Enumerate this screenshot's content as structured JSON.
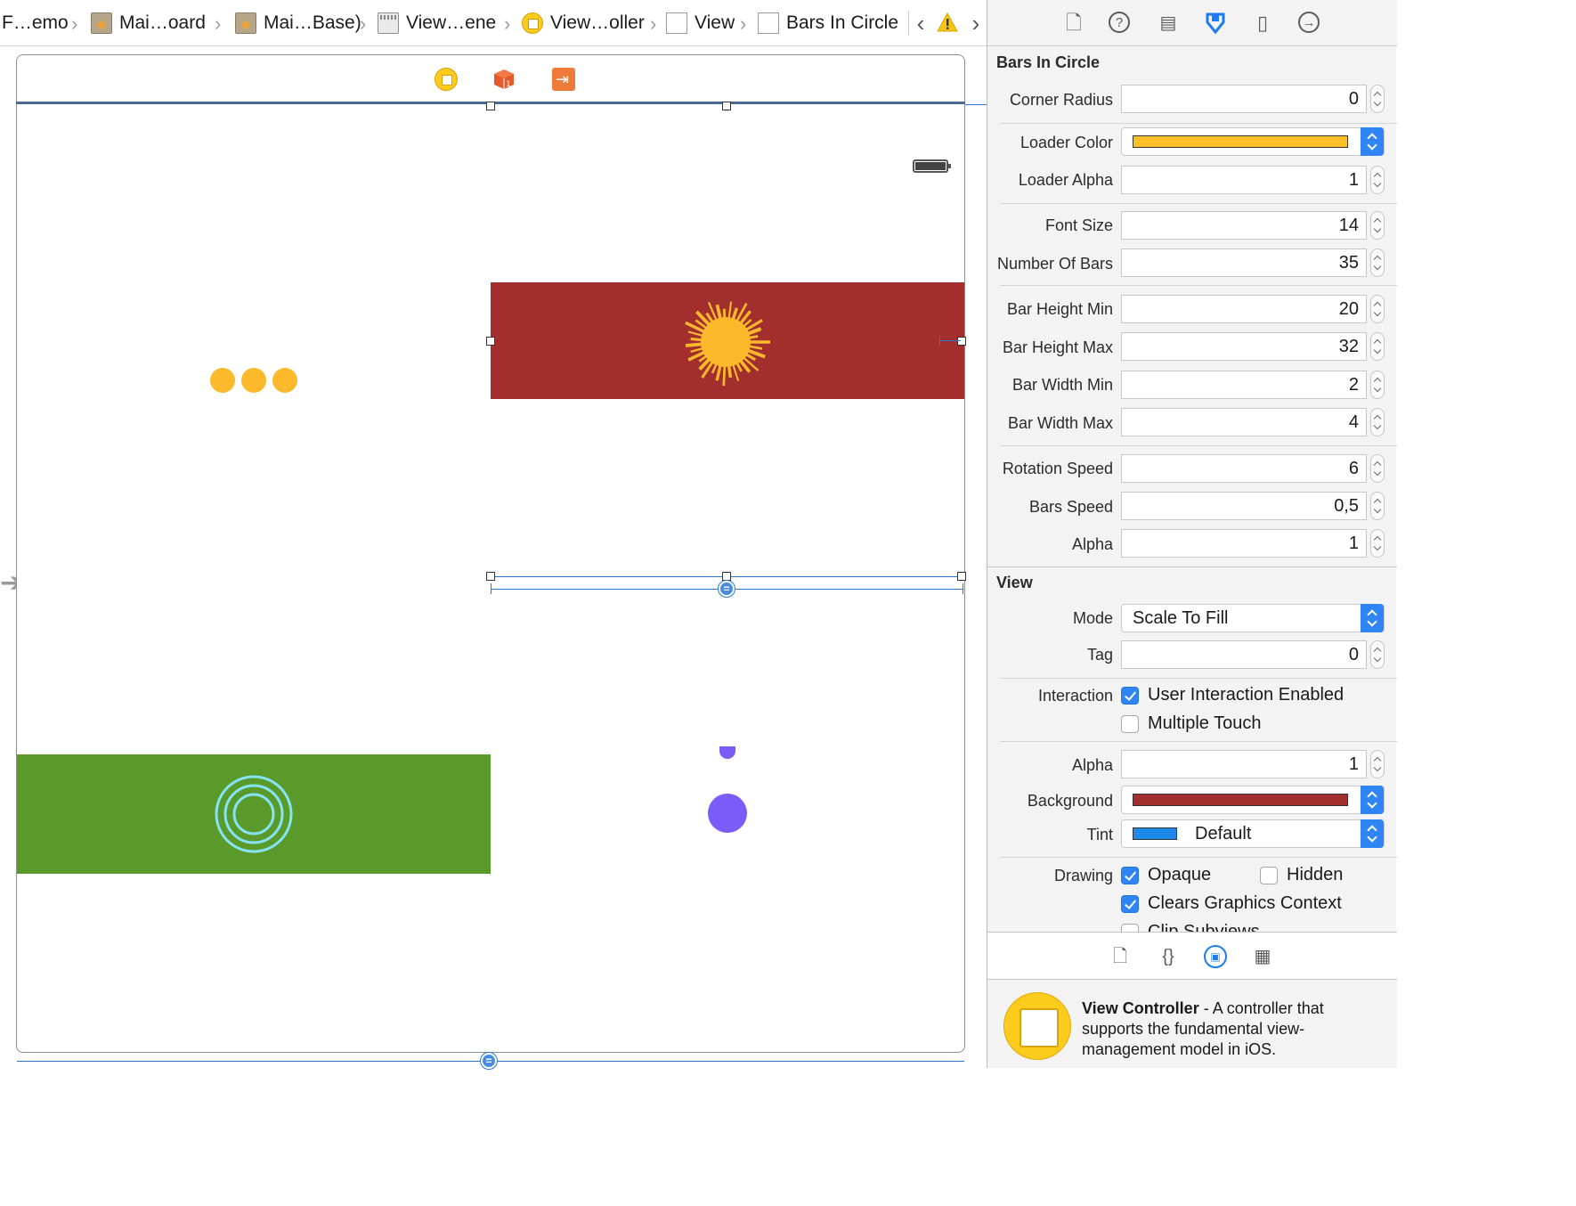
{
  "breadcrumb": {
    "items": [
      {
        "label": "F…emo",
        "icon": "none"
      },
      {
        "label": "Mai…oard",
        "icon": "storyboard-file-icon"
      },
      {
        "label": "Mai…Base)",
        "icon": "storyboard-file-icon"
      },
      {
        "label": "View…ene",
        "icon": "scene-icon"
      },
      {
        "label": "View…oller",
        "icon": "view-controller-icon"
      },
      {
        "label": "View",
        "icon": "view-icon"
      },
      {
        "label": "Bars In Circle",
        "icon": "view-icon"
      }
    ],
    "nav_back": "‹",
    "nav_forward": "›",
    "warning_icon": "warning-icon"
  },
  "canvas": {
    "red_view_color": "#a22e2e",
    "green_view_color": "#5a9a2a",
    "loader_color": "#fbb92b",
    "purple_color": "#7a5cf9",
    "ring_color": "#86e3f2",
    "constraint_symbol": "="
  },
  "inspector": {
    "tabs": [
      "file-icon",
      "help-icon",
      "identity-icon",
      "attributes-icon",
      "size-icon",
      "connections-icon"
    ],
    "section1_title": "Bars In Circle",
    "corner_radius": {
      "label": "Corner Radius",
      "value": "0"
    },
    "loader_color": {
      "label": "Loader Color",
      "color": "#fbbf2a"
    },
    "loader_alpha": {
      "label": "Loader Alpha",
      "value": "1"
    },
    "font_size": {
      "label": "Font Size",
      "value": "14"
    },
    "number_of_bars": {
      "label": "Number Of Bars",
      "value": "35"
    },
    "bar_height_min": {
      "label": "Bar Height Min",
      "value": "20"
    },
    "bar_height_max": {
      "label": "Bar Height Max",
      "value": "32"
    },
    "bar_width_min": {
      "label": "Bar Width Min",
      "value": "2"
    },
    "bar_width_max": {
      "label": "Bar Width Max",
      "value": "4"
    },
    "rotation_speed": {
      "label": "Rotation Speed",
      "value": "6"
    },
    "bars_speed": {
      "label": "Bars Speed",
      "value": "0,5"
    },
    "alpha1": {
      "label": "Alpha",
      "value": "1"
    },
    "section2_title": "View",
    "mode": {
      "label": "Mode",
      "value": "Scale To Fill"
    },
    "tag": {
      "label": "Tag",
      "value": "0"
    },
    "interaction": {
      "label": "Interaction",
      "user_interaction": "User Interaction Enabled",
      "multiple_touch": "Multiple Touch"
    },
    "alpha2": {
      "label": "Alpha",
      "value": "1"
    },
    "background": {
      "label": "Background",
      "color": "#a22e2e"
    },
    "tint": {
      "label": "Tint",
      "value": "Default",
      "color": "#1e8ae8"
    },
    "drawing": {
      "label": "Drawing",
      "opaque": "Opaque",
      "hidden": "Hidden",
      "clears": "Clears Graphics Context",
      "clip": "Clip Subviews"
    }
  },
  "library": {
    "tabs": [
      "file-template-icon",
      "code-snippet-icon",
      "object-library-icon",
      "media-library-icon"
    ],
    "object_title": "View Controller",
    "object_desc": " - A controller that supports the fundamental view-management model in iOS."
  }
}
